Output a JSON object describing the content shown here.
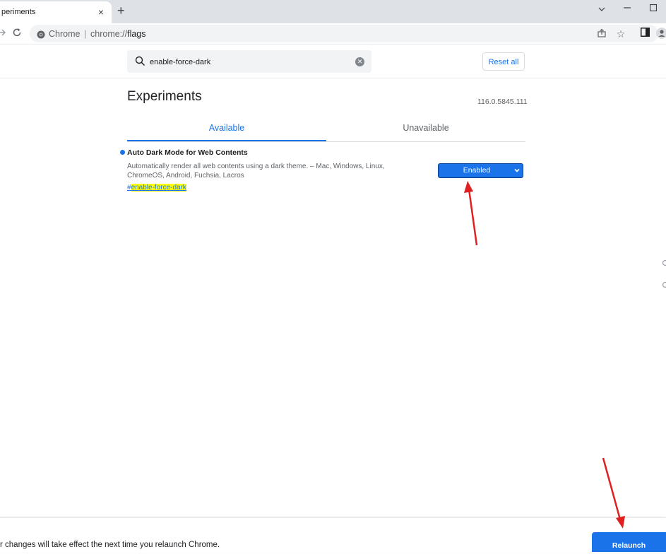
{
  "browser": {
    "tab_title": "periments",
    "tab_close": "×",
    "new_tab": "+",
    "omnibox_scheme": "Chrome",
    "omnibox_url_prefix": "chrome://",
    "omnibox_url_host": "flags"
  },
  "header": {
    "search_value": "enable-force-dark",
    "reset_label": "Reset all"
  },
  "page": {
    "title": "Experiments",
    "version": "116.0.5845.111"
  },
  "tabs": [
    {
      "label": "Available",
      "active": true
    },
    {
      "label": "Unavailable",
      "active": false
    }
  ],
  "experiment": {
    "name": "Auto Dark Mode for Web Contents",
    "description": "Automatically render all web contents using a dark theme. – Mac, Windows, Linux, ChromeOS, Android, Fuchsia, Lacros",
    "link_hash": "#",
    "link_text": "enable-force-dark",
    "selected_value": "Enabled"
  },
  "footer": {
    "message": "r changes will take effect the next time you relaunch Chrome.",
    "relaunch_label": "Relaunch"
  },
  "colors": {
    "accent": "#1a73e8",
    "annotation_arrow": "#e02020",
    "highlight": "#ffff00"
  }
}
